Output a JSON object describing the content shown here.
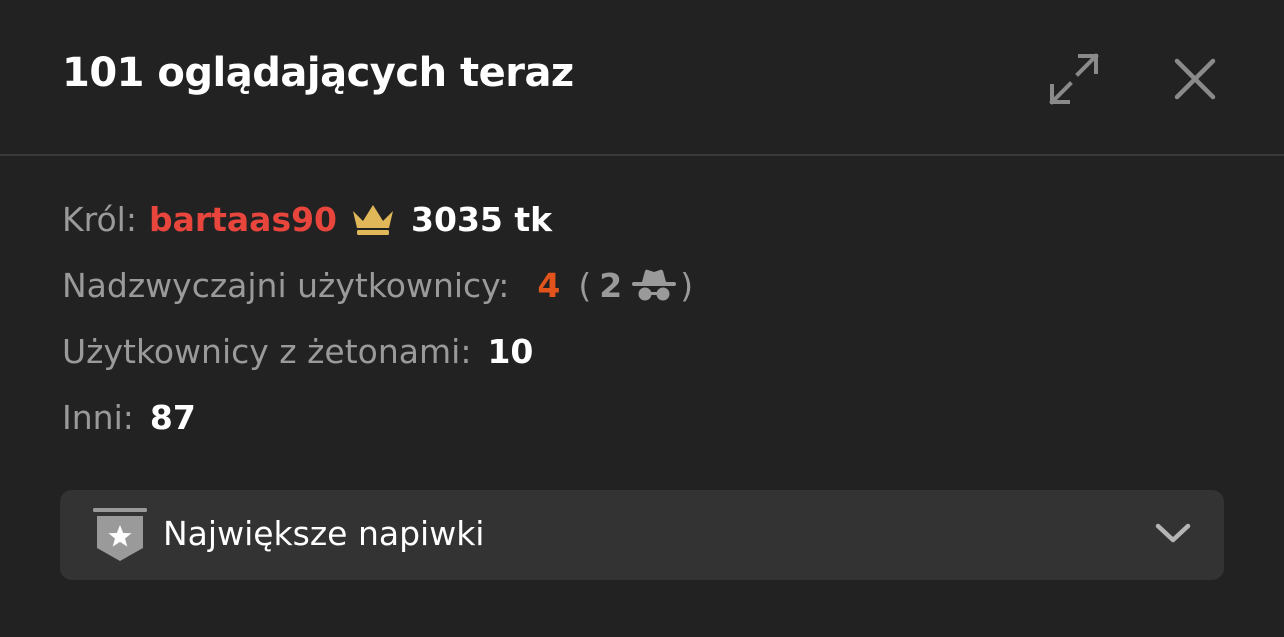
{
  "header": {
    "title": "101 oglądających teraz",
    "expand_icon": "expand-icon",
    "close_icon": "close-icon"
  },
  "stats": {
    "king": {
      "label": "Król:",
      "username": "bartaas90",
      "icon": "crown-icon",
      "tokens": "3035 tk"
    },
    "special_users": {
      "label": "Nadzwyczajni użytkownicy:",
      "count": "4",
      "paren_open": "(",
      "anonymous_count": "2",
      "anonymous_icon": "incognito-icon",
      "paren_close": ")"
    },
    "token_users": {
      "label": "Użytkownicy z żetonami:",
      "count": "10"
    },
    "others": {
      "label": "Inni:",
      "count": "87"
    }
  },
  "dropdown": {
    "label": "Największe napiwki",
    "icon": "star-badge-icon",
    "chevron": "chevron-down-icon"
  },
  "colors": {
    "background": "#222223",
    "king_name": "#e8453c",
    "special_count": "#e2541b",
    "crown": "#e0b85a",
    "label_grey": "#9a9a9b",
    "dropdown_bg": "#333334"
  }
}
